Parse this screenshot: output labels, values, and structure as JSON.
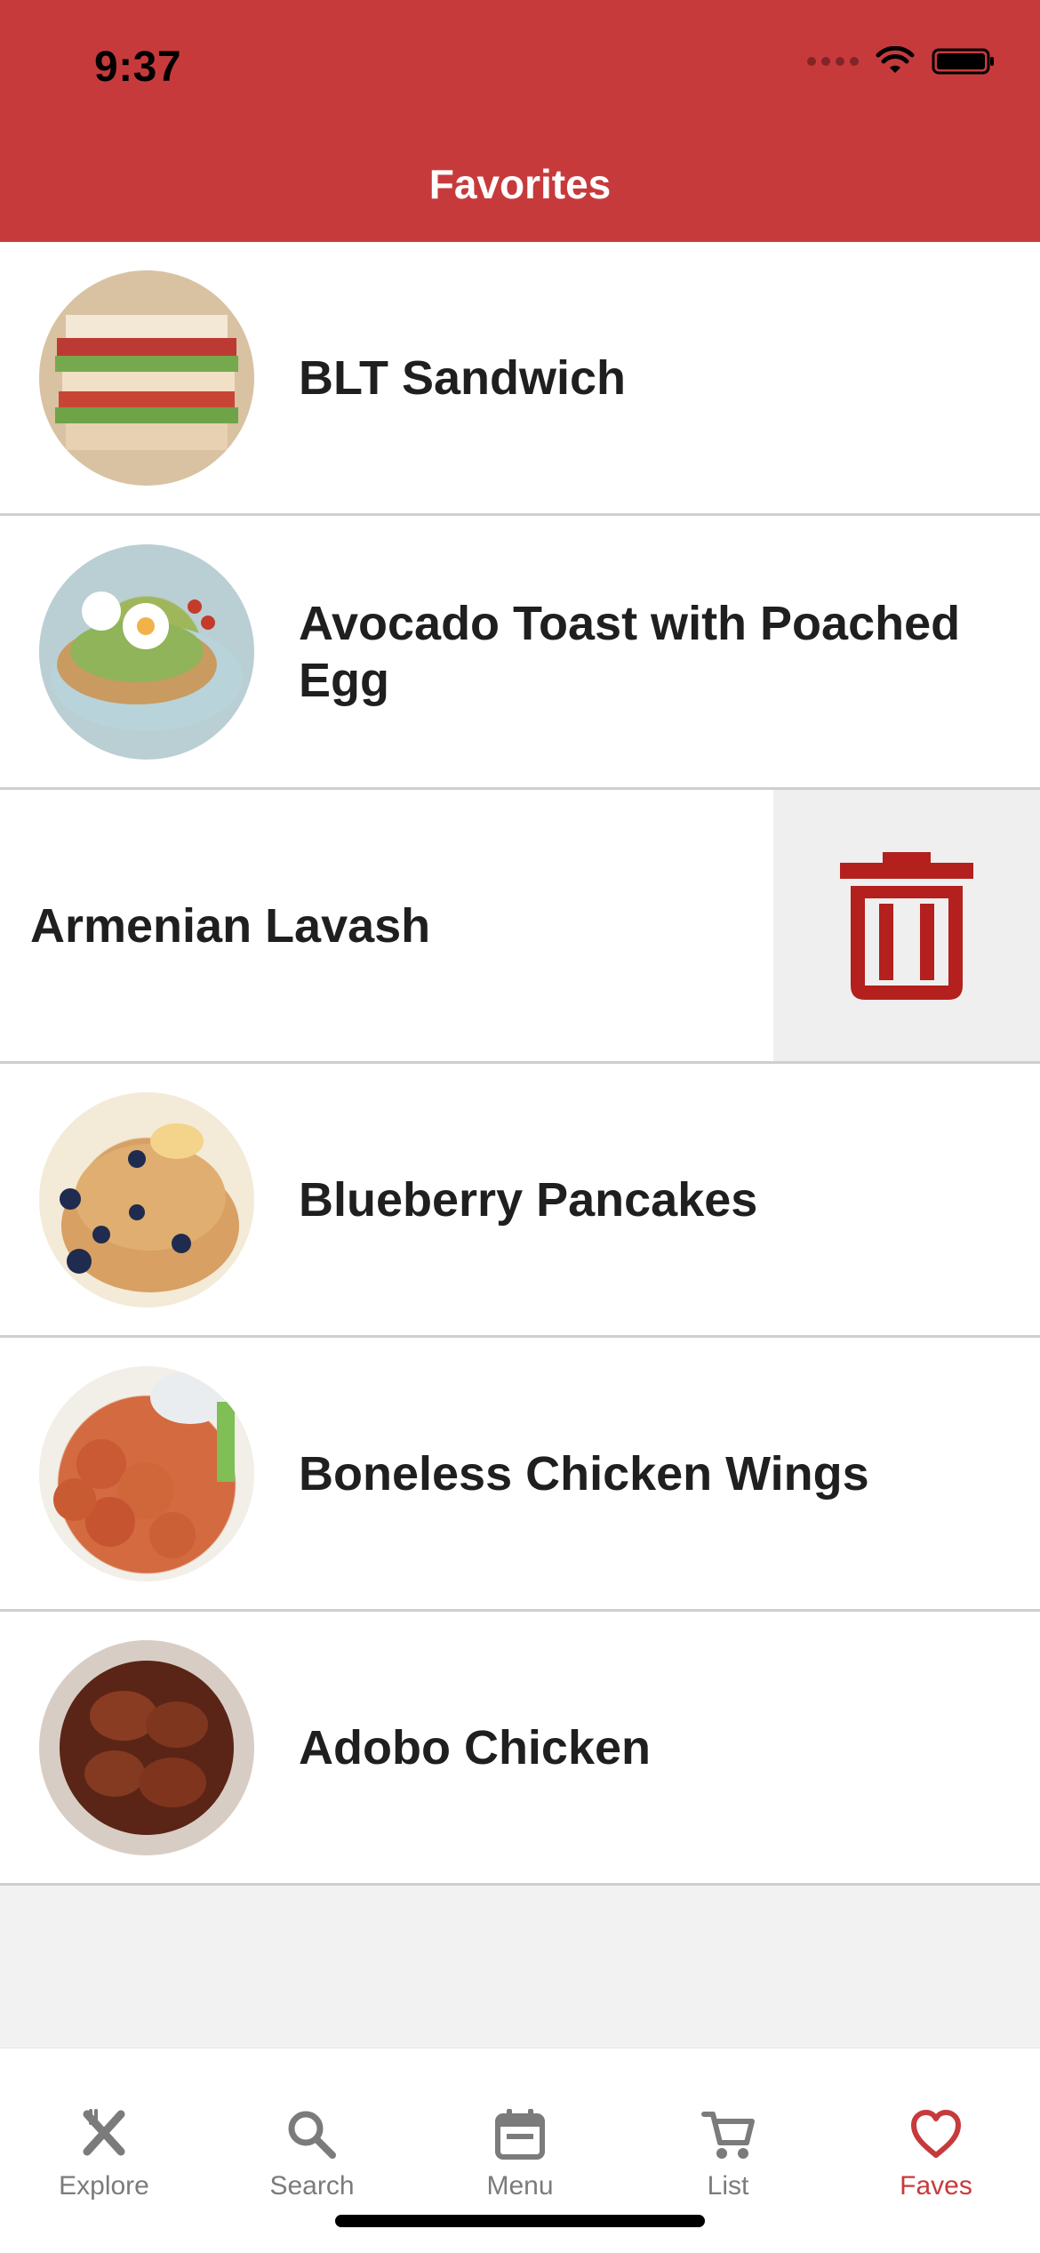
{
  "status_bar": {
    "time": "9:37"
  },
  "header": {
    "title": "Favorites",
    "bg_color": "#c73a3c"
  },
  "favorites": {
    "items": [
      {
        "title": "BLT Sandwich",
        "thumb": "blt"
      },
      {
        "title": "Avocado Toast with Poached Egg",
        "thumb": "avo"
      },
      {
        "title": "Armenian Lavash",
        "swiped": true,
        "action_icon": "trash-icon"
      },
      {
        "title": "Blueberry Pancakes",
        "thumb": "pan"
      },
      {
        "title": "Boneless Chicken Wings",
        "thumb": "wings"
      },
      {
        "title": "Adobo Chicken",
        "thumb": "adobo"
      }
    ]
  },
  "tab_bar": {
    "tabs": [
      {
        "label": "Explore",
        "icon": "fork-knife-icon",
        "active": false
      },
      {
        "label": "Search",
        "icon": "search-icon",
        "active": false
      },
      {
        "label": "Menu",
        "icon": "calendar-icon",
        "active": false
      },
      {
        "label": "List",
        "icon": "cart-icon",
        "active": false
      },
      {
        "label": "Faves",
        "icon": "heart-icon",
        "active": true
      }
    ],
    "active_color": "#c73a3c",
    "inactive_color": "#7b7b7b"
  }
}
